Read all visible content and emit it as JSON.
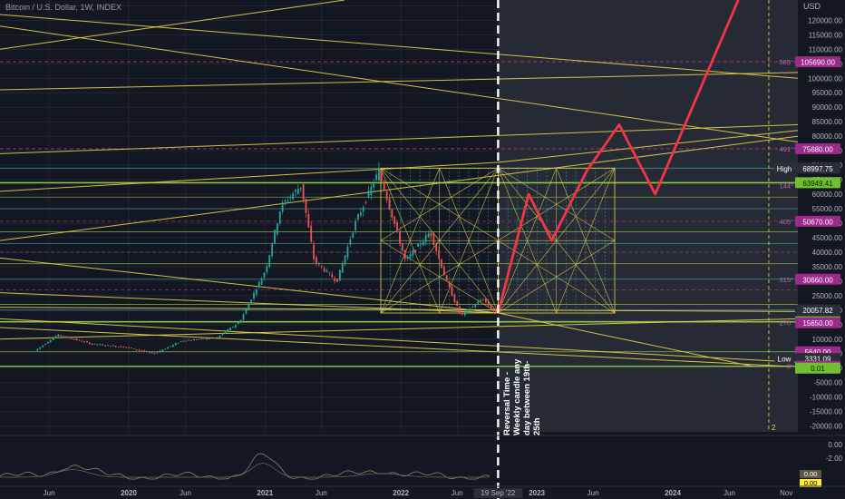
{
  "title": "Bitcoin / U.S. Dollar, 1W, INDEX",
  "colors": {
    "background": "#131722",
    "grid": "#2a2e39",
    "candle_up": "#26a69a",
    "candle_down": "#ef5350",
    "projection": "#f23645",
    "fib_lines": "#e6d34a",
    "cyan_lines": "#4fa7a3",
    "green_lines": "#8bc34a",
    "magenta_dash": "#b03a7a",
    "future_shade": "#262a35",
    "oscillator": "#8a8366"
  },
  "chart_data": {
    "type": "line",
    "y_unit": "USD",
    "x_ticks": [
      "Jun",
      "2020",
      "Jun",
      "2021",
      "Jun",
      "2022",
      "Jun",
      "19 Sep '22",
      "2023",
      "Jun",
      "2024",
      "Jun",
      "Nov"
    ],
    "y_ticks": [
      "125000.00",
      "120000.00",
      "115000.00",
      "110000.00",
      "105000.00",
      "100000.00",
      "95000.00",
      "90000.00",
      "85000.00",
      "80000.00",
      "75000.00",
      "70000.00",
      "65000.00",
      "60000.00",
      "55000.00",
      "50000.00",
      "45000.00",
      "40000.00",
      "35000.00",
      "30000.00",
      "25000.00",
      "20000.00",
      "15000.00",
      "10000.00",
      "5000.00",
      "0.00",
      "-5000.00",
      "-10000.00",
      "-15000.00",
      "-20000.00"
    ],
    "ylim": [
      -22000,
      127000
    ],
    "price_series": {
      "name": "",
      "x": [
        "2019-05-01",
        "2019-07-01",
        "2019-10-01",
        "2020-01-01",
        "2020-03-15",
        "2020-06-01",
        "2020-09-01",
        "2020-11-01",
        "2021-01-10",
        "2021-02-20",
        "2021-04-15",
        "2021-05-20",
        "2021-07-20",
        "2021-09-07",
        "2021-11-10",
        "2022-01-20",
        "2022-03-28",
        "2022-05-10",
        "2022-06-18",
        "2022-08-15",
        "2022-09-19"
      ],
      "y": [
        6000,
        11500,
        8300,
        7200,
        5000,
        9500,
        10500,
        16000,
        34000,
        56000,
        63000,
        37000,
        30000,
        50000,
        68000,
        37000,
        47000,
        30000,
        18000,
        24000,
        19000
      ]
    },
    "projection_series": {
      "name": "",
      "x": [
        "2022-09-19",
        "2022-12-10",
        "2023-02-10",
        "2023-05-15",
        "2023-08-10",
        "2023-11-15",
        "2024-06-25"
      ],
      "y": [
        19000,
        60000,
        44000,
        68000,
        84000,
        60000,
        127000
      ]
    },
    "price_labels": [
      {
        "text": "105690.00",
        "value": 105690,
        "kind": "magenta"
      },
      {
        "text": "75680.00",
        "value": 75680,
        "kind": "magenta"
      },
      {
        "text": "68997.75",
        "value": 68997.75,
        "kind": "high",
        "tag": "High"
      },
      {
        "text": "63949.41",
        "value": 63949.41,
        "kind": "green"
      },
      {
        "text": "50670.00",
        "value": 50670,
        "kind": "magenta"
      },
      {
        "text": "30660.00",
        "value": 30660,
        "kind": "magenta"
      },
      {
        "text": "20057.82",
        "value": 20057.82,
        "kind": "last",
        "sub": "3d 3h"
      },
      {
        "text": "15974.71",
        "value": 15974.71,
        "kind": "green"
      },
      {
        "text": "15650.00",
        "value": 15650,
        "kind": "magenta"
      },
      {
        "text": "5640.00",
        "value": 5640,
        "kind": "magenta"
      },
      {
        "text": "3331.09",
        "value": 3331.09,
        "kind": "low",
        "tag": "Low"
      },
      {
        "text": "630.00",
        "value": 630,
        "kind": "magenta"
      },
      {
        "text": "0.01",
        "value": 0.01,
        "kind": "green"
      }
    ],
    "fib_ratio_labels": [
      {
        "text": "585°",
        "value": 105690
      },
      {
        "text": "491°",
        "value": 75680
      },
      {
        "text": "144°",
        "value": 63000
      },
      {
        "text": "405°",
        "value": 50670
      },
      {
        "text": "315°",
        "value": 30660
      },
      {
        "text": "270°",
        "value": 15650
      },
      {
        "text": "0°",
        "value": 630
      }
    ],
    "horizontal_levels": [
      69000,
      63949,
      59000,
      55000,
      50670,
      47000,
      43000,
      40000,
      36000,
      30660,
      27000,
      22000,
      20000,
      15974,
      5640,
      630
    ],
    "vertical_marker": {
      "x": "2022-09-19"
    },
    "future_marker": {
      "x": "2024-09-15",
      "label": "2"
    },
    "annotation": "Reversal Time - Weekly candle any day between 19th- 25th",
    "oscillator": {
      "y_ticks": [
        "0.00",
        "-2.00"
      ],
      "value_labels": [
        "0.00",
        "0.00"
      ]
    },
    "grid": true,
    "legend": "none"
  }
}
